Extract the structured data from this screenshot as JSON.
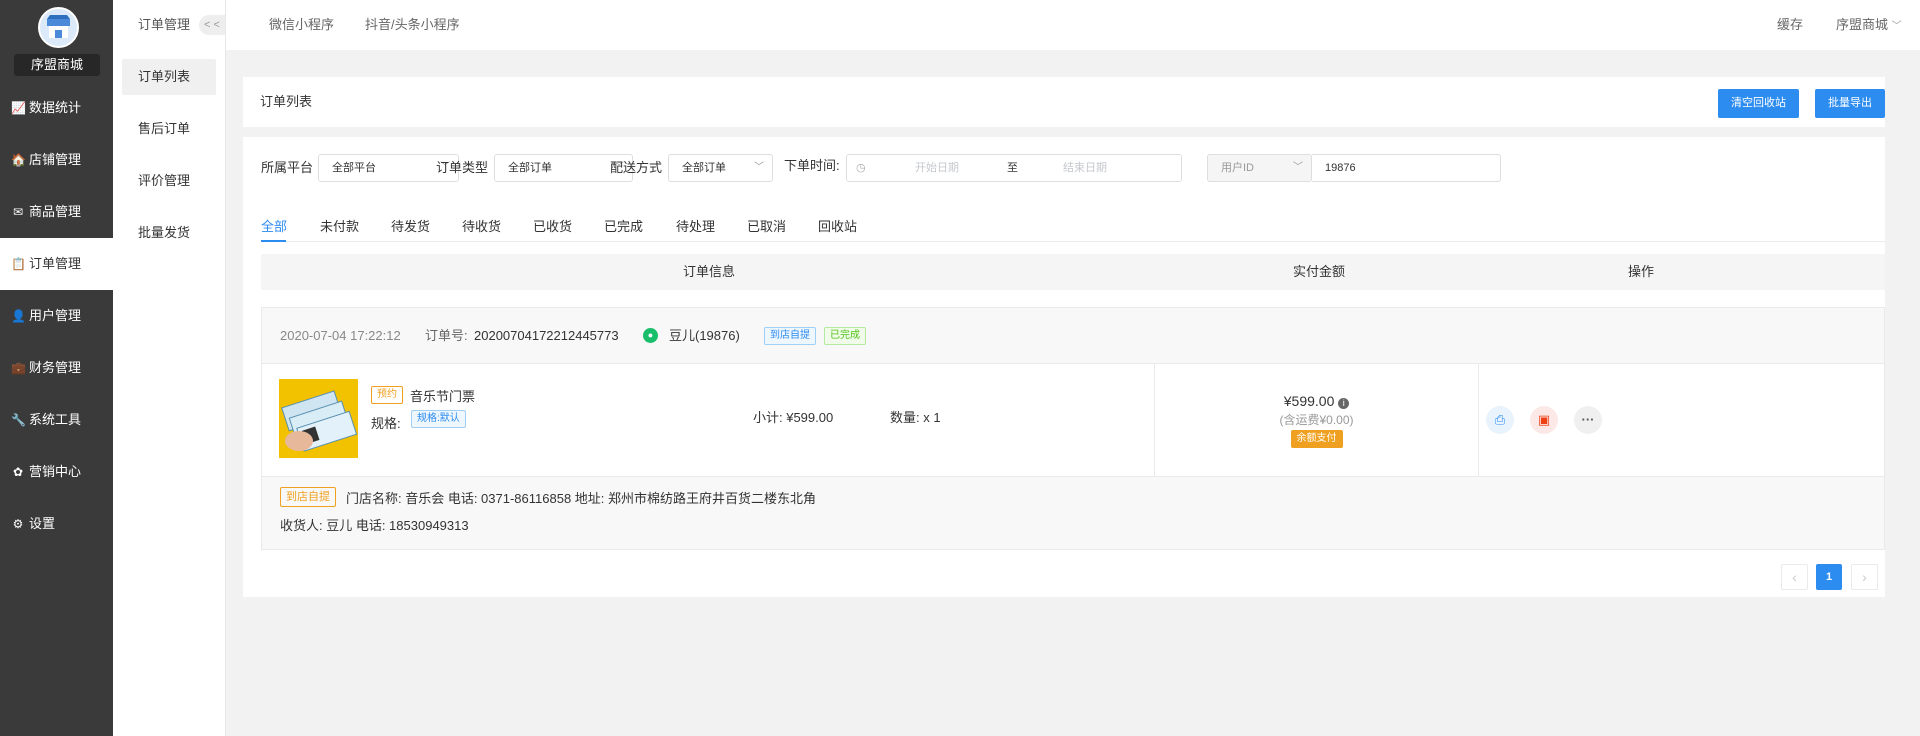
{
  "sidebar": {
    "shop_name": "序盟商城",
    "items": [
      {
        "label": "数据统计",
        "icon": "chart-icon",
        "glyph": "📈"
      },
      {
        "label": "店铺管理",
        "icon": "store-icon",
        "glyph": "🏠"
      },
      {
        "label": "商品管理",
        "icon": "box-icon",
        "glyph": "✉"
      },
      {
        "label": "订单管理",
        "icon": "order-icon",
        "glyph": "📋"
      },
      {
        "label": "用户管理",
        "icon": "user-icon",
        "glyph": "👤"
      },
      {
        "label": "财务管理",
        "icon": "wallet-icon",
        "glyph": "💼"
      },
      {
        "label": "系统工具",
        "icon": "wrench-icon",
        "glyph": "🔧"
      },
      {
        "label": "营销中心",
        "icon": "marketing-icon",
        "glyph": "✿"
      },
      {
        "label": "设置",
        "icon": "gear-icon",
        "glyph": "⚙"
      }
    ]
  },
  "subnav": {
    "title": "订单管理",
    "collapse": "< <",
    "items": [
      "订单列表",
      "售后订单",
      "评价管理",
      "批量发货"
    ]
  },
  "topbar": {
    "tabs": [
      "微信小程序",
      "抖音/头条小程序"
    ],
    "cache": "缓存",
    "user": "序盟商城"
  },
  "header": {
    "title": "订单列表",
    "clear_btn": "清空回收站",
    "export_btn": "批量导出"
  },
  "filters": {
    "platform_label": "所属平台",
    "platform_value": "全部平台",
    "type_label": "订单类型",
    "type_value": "全部订单",
    "delivery_label": "配送方式",
    "delivery_value": "全部订单",
    "time_label": "下单时间:",
    "start_placeholder": "开始日期",
    "to": "至",
    "end_placeholder": "结束日期",
    "search_type": "用户ID",
    "search_value": "19876"
  },
  "status_tabs": [
    "全部",
    "未付款",
    "待发货",
    "待收货",
    "已收货",
    "已完成",
    "待处理",
    "已取消",
    "回收站"
  ],
  "table": {
    "headers": {
      "info": "订单信息",
      "amount": "实付金额",
      "ops": "操作"
    }
  },
  "order": {
    "time": "2020-07-04 17:22:12",
    "order_no_label": "订单号:",
    "order_no": "20200704172212445773",
    "user": "豆儿(19876)",
    "tags": [
      "到店自提",
      "已完成"
    ],
    "product": {
      "badge": "预约",
      "name": "音乐节门票",
      "spec_label": "规格:",
      "spec": "规格:默认",
      "subtotal": "小计: ¥599.00",
      "qty": "数量: x 1"
    },
    "amount": "¥599.00",
    "shipping": "(含运费¥0.00)",
    "pay_method": "余额支付",
    "pickup_tag": "到店自提",
    "store_info": "门店名称: 音乐会 电话: 0371-86116858 地址: 郑州市棉纺路王府井百货二楼东北角",
    "receiver": "收货人: 豆儿 电话: 18530949313"
  },
  "pagination": {
    "prev": "‹",
    "current": "1",
    "next": "›"
  },
  "colors": {
    "accent": "#2d8cf0",
    "sidebar": "#3a3a3a",
    "orange": "#f0a020",
    "green": "#19be6b"
  }
}
